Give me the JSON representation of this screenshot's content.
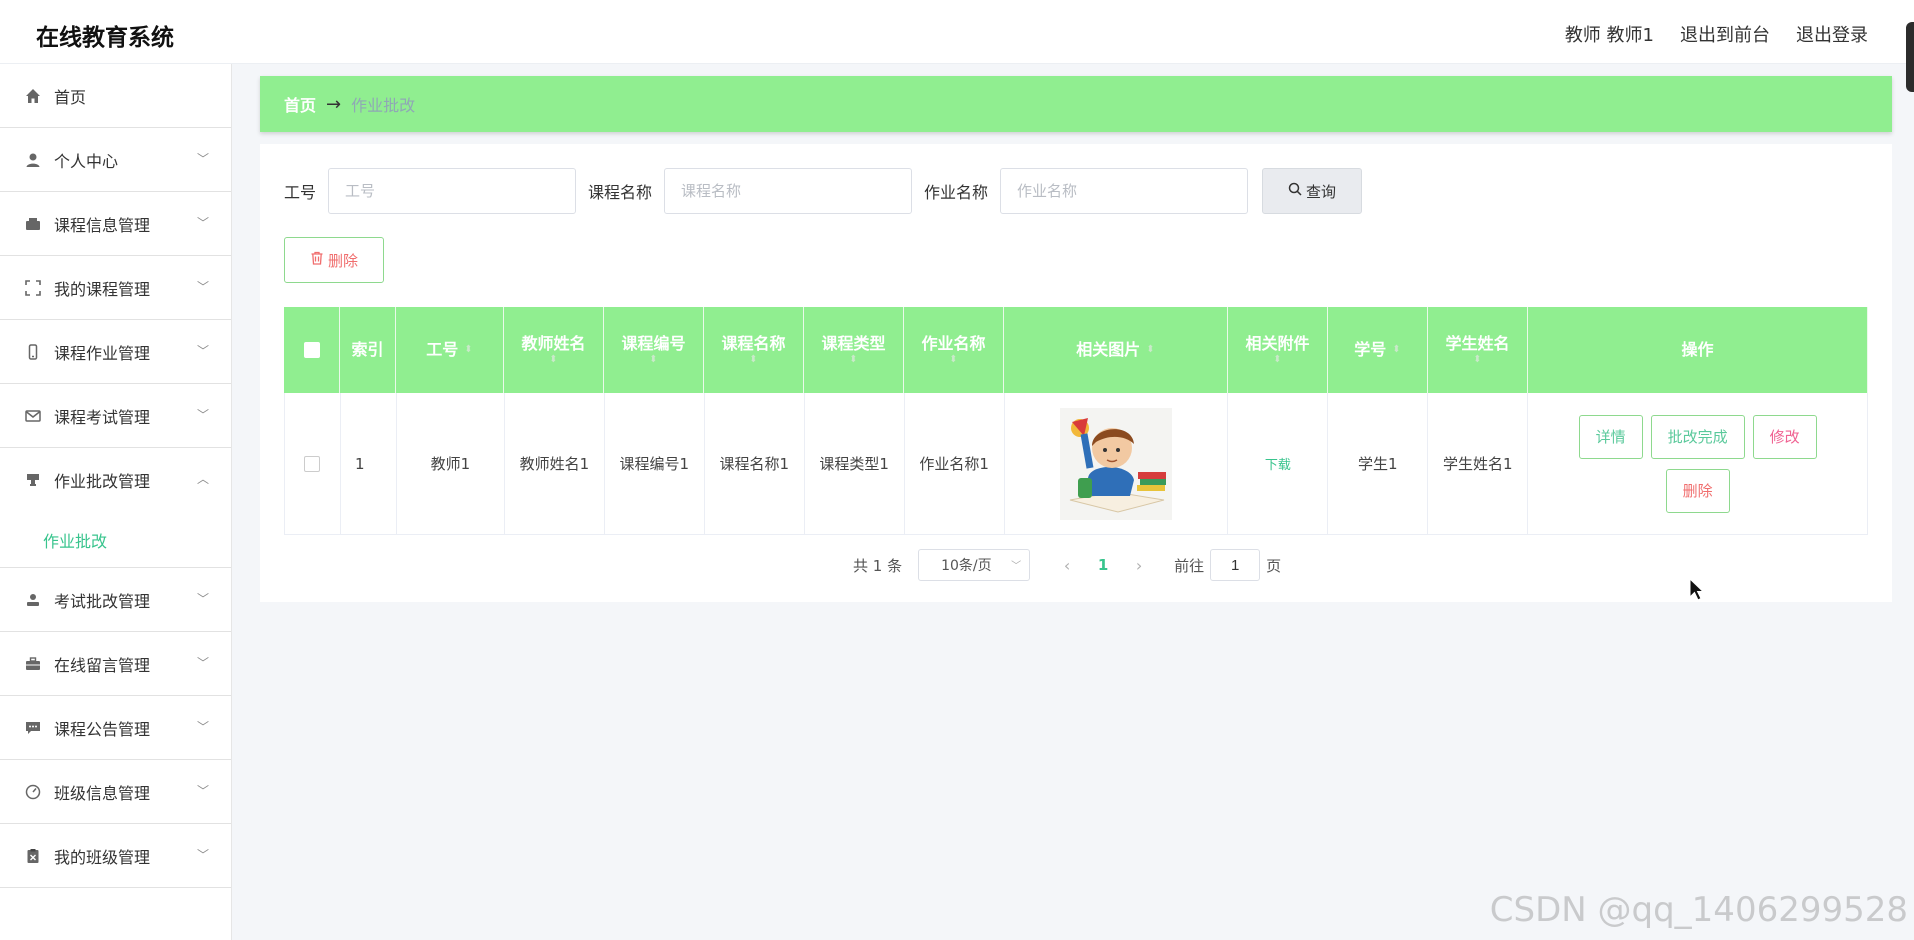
{
  "header": {
    "app_title": "在线教育系统",
    "user_label": "教师 教师1",
    "back_to_front": "退出到前台",
    "logout": "退出登录"
  },
  "sidebar": {
    "items": [
      {
        "label": "首页",
        "icon": "home-icon"
      },
      {
        "label": "个人中心",
        "icon": "user-icon"
      },
      {
        "label": "课程信息管理",
        "icon": "wallet-icon"
      },
      {
        "label": "我的课程管理",
        "icon": "fullscreen-icon"
      },
      {
        "label": "课程作业管理",
        "icon": "phone-icon"
      },
      {
        "label": "课程考试管理",
        "icon": "mail-icon"
      },
      {
        "label": "作业批改管理",
        "icon": "stamp-icon",
        "expanded": true
      },
      {
        "label": "考试批改管理",
        "icon": "person-icon"
      },
      {
        "label": "在线留言管理",
        "icon": "briefcase-icon"
      },
      {
        "label": "课程公告管理",
        "icon": "chat-icon"
      },
      {
        "label": "班级信息管理",
        "icon": "gauge-icon"
      },
      {
        "label": "我的班级管理",
        "icon": "clipboard-icon"
      }
    ],
    "active_sub": "作业批改"
  },
  "breadcrumb": {
    "home": "首页",
    "arrow": "→",
    "current": "作业批改"
  },
  "search": {
    "field1_label": "工号",
    "field1_placeholder": "工号",
    "field2_label": "课程名称",
    "field2_placeholder": "课程名称",
    "field3_label": "作业名称",
    "field3_placeholder": "作业名称",
    "query_button": "查询"
  },
  "toolbar": {
    "delete_label": "删除"
  },
  "table": {
    "headers": [
      "索引",
      "工号",
      "教师姓名",
      "课程编号",
      "课程名称",
      "课程类型",
      "作业名称",
      "相关图片",
      "相关附件",
      "学号",
      "学生姓名",
      "操作"
    ],
    "rows": [
      {
        "index": "1",
        "teacher_id": "教师1",
        "teacher_name": "教师姓名1",
        "course_no": "课程编号1",
        "course_name": "课程名称1",
        "course_type": "课程类型1",
        "homework_name": "作业名称1",
        "attachment": "下载",
        "student_no": "学生1",
        "student_name": "学生姓名1"
      }
    ],
    "actions": {
      "detail": "详情",
      "grade_done": "批改完成",
      "edit": "修改",
      "delete": "删除"
    }
  },
  "pagination": {
    "total": "共 1 条",
    "page_size": "10条/页",
    "current_page": "1",
    "goto_label": "前往",
    "goto_value": "1",
    "page_unit": "页"
  },
  "watermark": "CSDN @qq_1406299528",
  "colors": {
    "accent_green": "#90ee90",
    "link_green": "#38c48d",
    "danger": "#f06d6d"
  }
}
